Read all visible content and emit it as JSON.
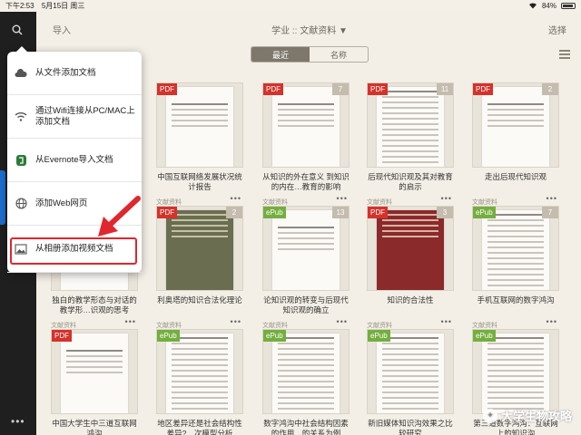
{
  "status": {
    "time": "下午2:53",
    "date": "5月15日 周三",
    "battery": "84%"
  },
  "topbar": {
    "import": "导入",
    "title": "学业 :: 文献资料 ▼",
    "select": "选择"
  },
  "segment": {
    "recent": "最近",
    "name": "名称"
  },
  "popup": {
    "items": [
      {
        "label": "从文件添加文档",
        "icon": "cloud-icon"
      },
      {
        "label": "通过Wifi连接从PC/MAC上添加文档",
        "icon": "wifi-icon"
      },
      {
        "label": "从Evernote导入文档",
        "icon": "evernote-icon"
      },
      {
        "label": "添加Web网页",
        "icon": "globe-icon"
      },
      {
        "label": "从相册添加视频文档",
        "icon": "photo-icon"
      }
    ]
  },
  "cards": [
    {
      "type": "PDF",
      "count": "",
      "title": "中国互联网络发展状况统计报告",
      "sub": "文献资料"
    },
    {
      "type": "PDF",
      "count": "7",
      "title": "从知识的外在意义 到知识的内在…教育的影响",
      "sub": "文献资料"
    },
    {
      "type": "PDF",
      "count": "11",
      "title": "后现代知识观及其对教育的启示",
      "sub": "文献资料"
    },
    {
      "type": "PDF",
      "count": "2",
      "title": "走出后现代知识观",
      "sub": "文献资料"
    },
    {
      "type": "",
      "count": "",
      "title": "独白的教学形态与对话的教学形…识观的思考",
      "sub": "文献资料"
    },
    {
      "type": "PDF",
      "count": "2",
      "title": "利奥塔的知识合法化理论",
      "sub": "文献资料"
    },
    {
      "type": "ePub",
      "count": "13",
      "title": "论知识观的转变与后现代知识观的确立",
      "sub": "文献资料"
    },
    {
      "type": "PDF",
      "count": "3",
      "title": "知识的合法性",
      "sub": "文献资料"
    },
    {
      "type": "ePub",
      "count": "7",
      "title": "手机互联网的数字鸿沟",
      "sub": "文献资料"
    },
    {
      "type": "PDF",
      "count": "",
      "title": "中国大学生中三道互联网鸿沟",
      "sub": ""
    },
    {
      "type": "ePub",
      "count": "",
      "title": "地区差异还是社会结构性差异?…次模型分析",
      "sub": ""
    },
    {
      "type": "ePub",
      "count": "",
      "title": "数字鸿沟中社会结构因素的作用…的关系为例",
      "sub": ""
    },
    {
      "type": "ePub",
      "count": "",
      "title": "新旧媒体知识沟效果之比较研究",
      "sub": ""
    },
    {
      "type": "ePub",
      "count": "",
      "title": "第三道数字鸿沟：互联网上的知识沟",
      "sub": ""
    }
  ],
  "watermark": {
    "text": "大学生物攻略"
  }
}
